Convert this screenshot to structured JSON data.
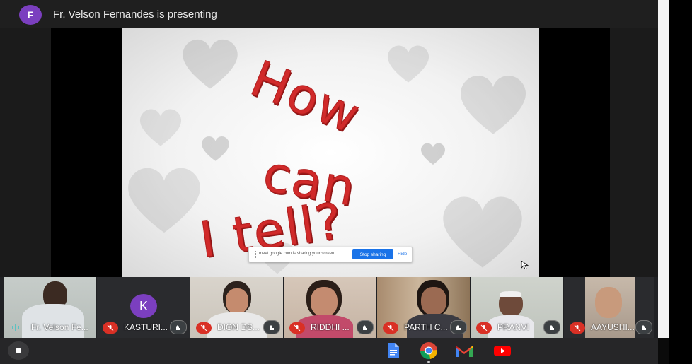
{
  "meeting": {
    "presenter_initial": "F",
    "presenting_text": "Fr. Velson Fernandes is presenting"
  },
  "slide": {
    "line1": "How",
    "line2": "can",
    "line3": "I tell?"
  },
  "share_bar": {
    "message": "meet.google.com is sharing your screen.",
    "stop_label": "Stop sharing",
    "hide_label": "Hide"
  },
  "participants": [
    {
      "name": "Fr. Velson Fe...",
      "state": "speaking"
    },
    {
      "name": "KASTURI...",
      "initial": "K",
      "state": "muted"
    },
    {
      "name": "DION DS...",
      "state": "muted"
    },
    {
      "name": "RIDDHI ...",
      "state": "muted"
    },
    {
      "name": "PARTH C...",
      "state": "muted"
    },
    {
      "name": "PRANVI",
      "state": "muted"
    },
    {
      "name": "AAYUSHI...",
      "state": "muted"
    }
  ],
  "taskbar": {
    "apps": [
      "google-docs-icon",
      "chrome-icon",
      "gmail-icon",
      "youtube-icon"
    ]
  },
  "colors": {
    "accent_purple": "#7b3fbf",
    "mute_red": "#d93025",
    "button_blue": "#1a73e8",
    "slide_text_red": "#d02a2a"
  }
}
